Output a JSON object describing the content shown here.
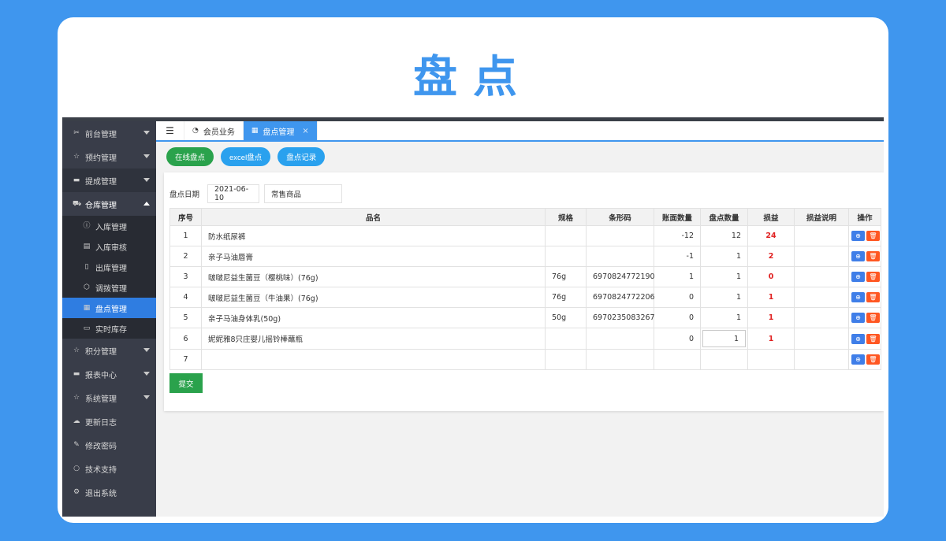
{
  "hero_title": "盘点",
  "sidebar": {
    "items": [
      {
        "label": "前台管理",
        "icon": "scissors-icon",
        "expandable": true
      },
      {
        "label": "预约管理",
        "icon": "star-icon",
        "expandable": true
      },
      {
        "label": "提成管理",
        "icon": "card-icon",
        "expandable": true
      },
      {
        "label": "仓库管理",
        "icon": "warehouse-icon",
        "expandable": true,
        "open": true
      }
    ],
    "sub_items": [
      {
        "label": "入库管理",
        "icon": "info-icon"
      },
      {
        "label": "入库审核",
        "icon": "list-icon"
      },
      {
        "label": "出库管理",
        "icon": "document-icon"
      },
      {
        "label": "调拨管理",
        "icon": "cube-icon"
      },
      {
        "label": "盘点管理",
        "icon": "table-icon",
        "active": true
      },
      {
        "label": "实时库存",
        "icon": "clipboard-icon"
      }
    ],
    "bottom_items": [
      {
        "label": "积分管理",
        "icon": "star-icon",
        "expandable": true
      },
      {
        "label": "报表中心",
        "icon": "chat-icon",
        "expandable": true
      },
      {
        "label": "系统管理",
        "icon": "star-icon",
        "expandable": true
      },
      {
        "label": "更新日志",
        "icon": "cloud-icon"
      },
      {
        "label": "修改密码",
        "icon": "edit-icon"
      },
      {
        "label": "技术支持",
        "icon": "bubble-icon"
      },
      {
        "label": "退出系统",
        "icon": "gears-icon"
      }
    ]
  },
  "tabs": [
    {
      "label": "会员业务",
      "icon": "dashboard-icon"
    },
    {
      "label": "盘点管理",
      "icon": "table-icon",
      "active": true,
      "close": "×"
    }
  ],
  "tab_toggle_icon": "☰",
  "buttons": {
    "online": "在线盘点",
    "excel": "excel盘点",
    "records": "盘点记录"
  },
  "filter": {
    "date_label": "盘点日期",
    "date_value": "2021-06-10",
    "category_value": "常售商品"
  },
  "table": {
    "headers": [
      "序号",
      "品名",
      "规格",
      "条形码",
      "账面数量",
      "盘点数量",
      "损益",
      "损益说明",
      "操作"
    ],
    "rows": [
      {
        "no": "1",
        "name": "防水纸尿裤",
        "spec": "",
        "barcode": "",
        "book_qty": "-12",
        "count_qty": "12",
        "diff": "24",
        "note": ""
      },
      {
        "no": "2",
        "name": "亲子马油唇膏",
        "spec": "",
        "barcode": "",
        "book_qty": "-1",
        "count_qty": "1",
        "diff": "2",
        "note": ""
      },
      {
        "no": "3",
        "name": "啵啵尼益生菌豆（樱桃味）(76g)",
        "spec": "76g",
        "barcode": "6970824772190",
        "book_qty": "1",
        "count_qty": "1",
        "diff": "0",
        "note": ""
      },
      {
        "no": "4",
        "name": "啵啵尼益生菌豆（牛油果）(76g)",
        "spec": "76g",
        "barcode": "6970824772206",
        "book_qty": "0",
        "count_qty": "1",
        "diff": "1",
        "note": ""
      },
      {
        "no": "5",
        "name": "亲子马油身体乳(50g)",
        "spec": "50g",
        "barcode": "6970235083267",
        "book_qty": "0",
        "count_qty": "1",
        "diff": "1",
        "note": ""
      },
      {
        "no": "6",
        "name": "妮妮雅8只庄婴儿摇铃棒蘸瓶",
        "spec": "",
        "barcode": "",
        "book_qty": "0",
        "count_qty": "1",
        "diff": "1",
        "note": "",
        "editing": true
      },
      {
        "no": "7",
        "name": "",
        "spec": "",
        "barcode": "",
        "book_qty": "",
        "count_qty": "",
        "diff": "",
        "note": ""
      }
    ],
    "op_add_icon": "⊕",
    "op_del_icon": "🗑"
  },
  "submit_label": "提交",
  "colors": {
    "background": "#3f96ee",
    "sidebar": "#393d49",
    "active": "#2f7de1",
    "green": "#2aa24c",
    "loss_red": "#e02020",
    "delete_orange": "#ff5722"
  }
}
